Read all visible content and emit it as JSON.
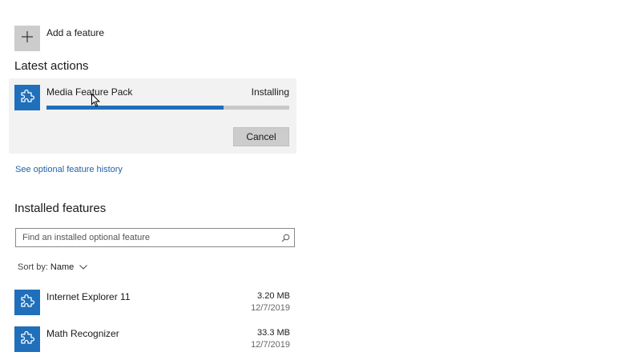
{
  "add_feature": {
    "label": "Add a feature",
    "icon": "plus-icon"
  },
  "latest_actions": {
    "title": "Latest actions",
    "item": {
      "name": "Media Feature Pack",
      "status": "Installing",
      "progress": 0.73,
      "icon": "puzzle-icon",
      "cancel_label": "Cancel"
    }
  },
  "history_link": "See optional feature history",
  "installed": {
    "title": "Installed features",
    "search_placeholder": "Find an installed optional feature",
    "sort_by_label": "Sort by:",
    "sort_by_value": "Name",
    "items": [
      {
        "name": "Internet Explorer 11",
        "size": "3.20 MB",
        "date": "12/7/2019",
        "icon": "puzzle-icon"
      },
      {
        "name": "Math Recognizer",
        "size": "33.3 MB",
        "date": "12/7/2019",
        "icon": "puzzle-icon"
      }
    ]
  },
  "colors": {
    "accent": "#1f6fba",
    "link": "#2163a8",
    "card_bg": "#f2f2f2",
    "button_bg": "#cccccc"
  }
}
